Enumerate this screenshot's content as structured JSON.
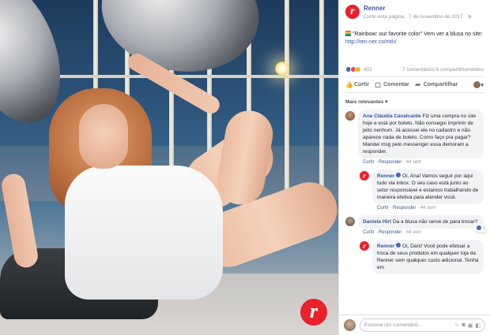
{
  "colors": {
    "brand": "#e8212b",
    "link": "#365899",
    "muted": "#90949c"
  },
  "photo": {
    "brand_mark": "r"
  },
  "post": {
    "page_logo": "r",
    "page_name": "Renner",
    "meta": "Curtir esta página · 7 de novembro de 2017 · ",
    "caption_text": "\"Rainbow: our favorite color\" Vem ver a blusa no site: ",
    "caption_link": "http://ren-ner.co/mtiV",
    "reactions_count": "402",
    "stats_right": "7 comentários  6 compartilhamentos",
    "actions": {
      "like": "Curtir",
      "comment": "Comentar",
      "share": "Compartilhar"
    },
    "sort_label": "Mais relevantes ▾"
  },
  "comments": [
    {
      "author": "Ana Cláudia Cavalcante",
      "text": "Fiz uma compra no site hoje e está por boleto. Não consegui imprimir de jeito nenhum. Já acessei ele no cadastro e não aparece nada de boleto. Como faço pra pagar? Mandei msg pelo messenger essa demoram a responder.",
      "like": "Curtir",
      "reply": "Responder",
      "time": "44 sem"
    },
    {
      "author": "Renner",
      "text": "Oi, Ana! Vamos seguir por aqui tudo via inbox. O seu caso está junto ao setor responsável e estamos trabalhando de maneira efetiva para atender você.",
      "like": "Curtir",
      "reply": "Responder",
      "time": "44 sem"
    },
    {
      "author": "Daniela Hirt",
      "text": "Da a blusa não serve de para trocar?",
      "like": "Curtir",
      "reply": "Responder",
      "time": "44 sem",
      "likes": "1"
    },
    {
      "author": "Renner",
      "text": "Oi, Dani! Você pode efetuar a troca de seus produtos em qualquer loja da Renner sem qualquer custo adicional. Tenha em"
    }
  ],
  "composer": {
    "placeholder": "Escreva um comentário..."
  }
}
